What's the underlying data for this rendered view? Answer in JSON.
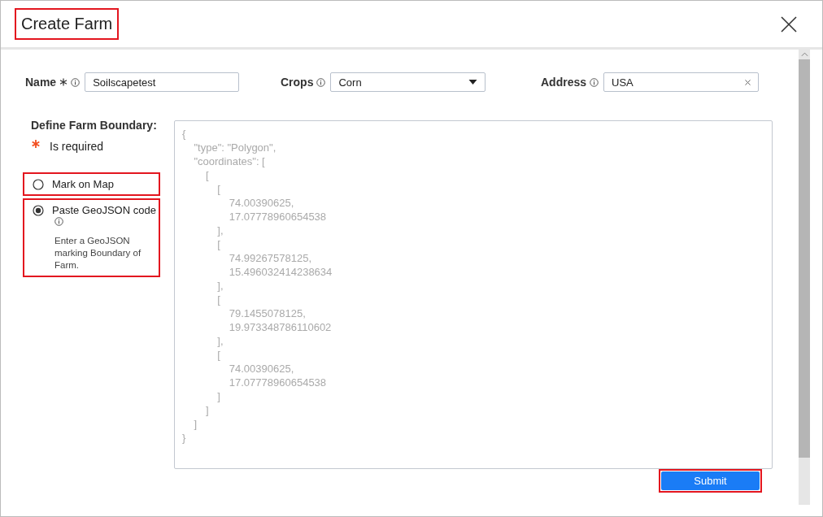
{
  "dialog": {
    "title": "Create Farm",
    "title_highlighted": true
  },
  "fields": [
    {
      "kind": "text",
      "label": "Name",
      "required": true,
      "value": "Soilscapetest"
    },
    {
      "kind": "dropdown",
      "label": "Crops",
      "required": false,
      "value": "Corn"
    },
    {
      "kind": "clearable",
      "label": "Address",
      "required": false,
      "value": "USA"
    }
  ],
  "boundary": {
    "label": "Define Farm Boundary:",
    "required_note": "Is required",
    "options": [
      {
        "label": "Mark on Map",
        "selected": false,
        "highlighted": true
      },
      {
        "label": "Paste GeoJSON code",
        "selected": true,
        "highlighted": true,
        "help": "Enter a GeoJSON marking Boundary of Farm."
      }
    ],
    "geojson": {
      "placeholder": "{\n    \"type\": \"Polygon\",\n    \"coordinates\": [\n        [\n            [\n                74.00390625,\n                17.07778960654538\n            ],\n            [\n                74.99267578125,\n                15.496032414238634\n            ],\n            [\n                79.1455078125,\n                19.973348786110602\n            ],\n            [\n                74.00390625,\n                17.07778960654538\n            ]\n        ]\n    ]\n}"
    }
  },
  "submit": {
    "label": "Submit",
    "highlighted": true
  }
}
